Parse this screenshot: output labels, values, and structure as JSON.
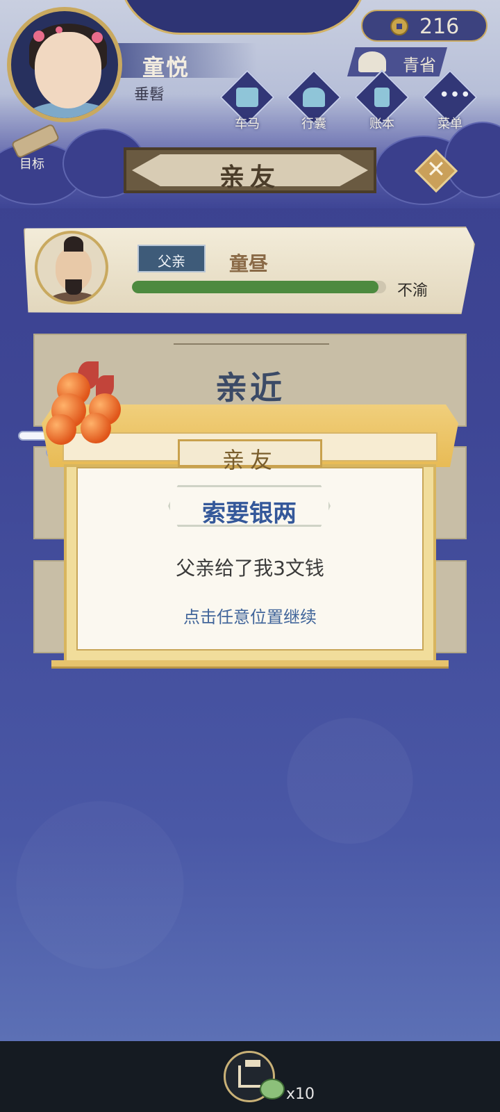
{
  "player": {
    "name": "童悦",
    "subtitle": "垂髫"
  },
  "currency": {
    "amount": "216",
    "icon": "copper-coin-icon"
  },
  "season": {
    "label": "青省",
    "icon": "teapot-icon"
  },
  "menu": [
    {
      "label": "车马",
      "icon": "carriage-icon"
    },
    {
      "label": "行囊",
      "icon": "bag-icon"
    },
    {
      "label": "账本",
      "icon": "ledger-icon"
    },
    {
      "label": "菜单",
      "icon": "more-icon"
    }
  ],
  "goal": {
    "label": "目标",
    "icon": "scroll-icon"
  },
  "panel": {
    "title": "亲友",
    "close_icon": "close-icon"
  },
  "relative": {
    "role": "父亲",
    "name": "童昼",
    "mood_label": "不渝",
    "mood_level": 0.97,
    "mood_color": "#4d8a3f"
  },
  "options": [
    {
      "label": "亲近"
    }
  ],
  "dialog": {
    "header": "亲友",
    "action": "索要银两",
    "message": "父亲给了我3文钱",
    "hint": "点击任意位置继续"
  },
  "bottom": {
    "share_icon": "share-icon",
    "count": "x10"
  },
  "colors": {
    "background": "#3e4695",
    "accent_gold": "#e8bb55",
    "title_blue": "#34589a"
  }
}
